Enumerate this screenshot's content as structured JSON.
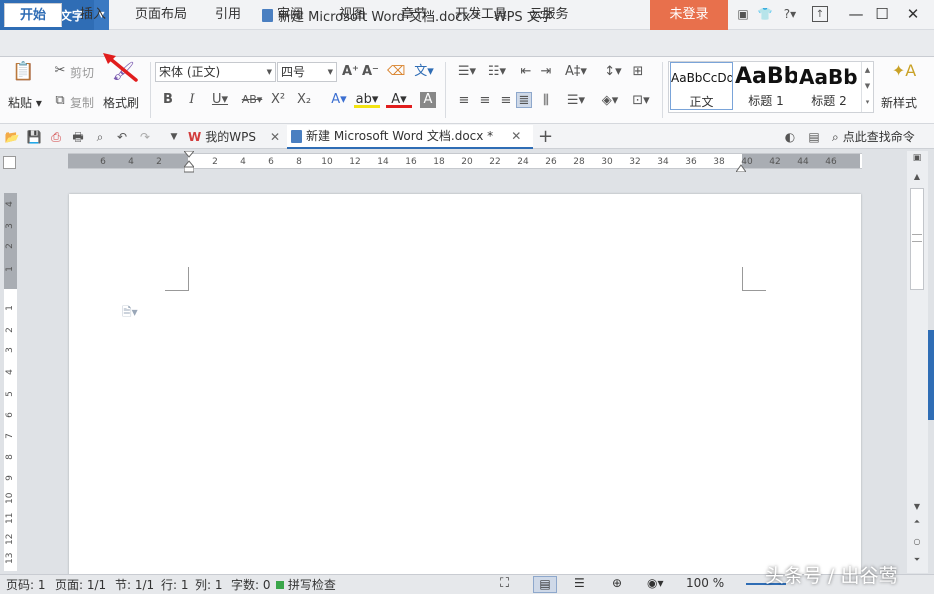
{
  "app": {
    "name": "WPS 文字",
    "doc_title": "新建 Microsoft Word 文档.docx * - WPS 文字",
    "login_label": "未登录",
    "help_label": "?"
  },
  "menu": {
    "tabs": [
      "开始",
      "插入",
      "页面布局",
      "引用",
      "审阅",
      "视图",
      "章节",
      "开发工具",
      "云服务"
    ],
    "active_index": 0
  },
  "ribbon": {
    "paste_label": "粘贴",
    "cut_label": "剪切",
    "copy_label": "复制",
    "format_painter_label": "格式刷",
    "font_name": "宋体 (正文)",
    "font_size": "四号",
    "styles": [
      {
        "preview": "AaBbCcDd",
        "name": "正文"
      },
      {
        "preview": "AaBb",
        "name": "标题 1"
      },
      {
        "preview": "AaBb(",
        "name": "标题 2"
      }
    ],
    "new_style_label": "新样式"
  },
  "tabs_bar": {
    "home_tab": "我的WPS",
    "doc_tab": "新建 Microsoft Word 文档.docx *",
    "add_tab": "+",
    "find_label": "点此查找命令"
  },
  "ruler": {
    "h_labels": [
      "6",
      "4",
      "2",
      "2",
      "4",
      "6",
      "8",
      "10",
      "12",
      "14",
      "16",
      "18",
      "20",
      "22",
      "24",
      "26",
      "28",
      "30",
      "32",
      "34",
      "36",
      "38",
      "40",
      "42",
      "44",
      "46"
    ],
    "v_labels": [
      "4",
      "3",
      "2",
      "1",
      "1",
      "2",
      "3",
      "4",
      "5",
      "6",
      "7",
      "8",
      "9",
      "10",
      "11",
      "12",
      "13"
    ]
  },
  "status": {
    "page_num": "页码: 1",
    "pages": "页面: 1/1",
    "section": "节: 1/1",
    "row": "行: 1",
    "col": "列: 1",
    "word_count": "字数: 0",
    "spell_check": "拼写检查",
    "zoom": "100 %"
  },
  "watermark": "头条号 / 出谷莺",
  "colors": {
    "accent": "#2f6db5",
    "login": "#e8704c",
    "arrow": "#e11d1d"
  }
}
